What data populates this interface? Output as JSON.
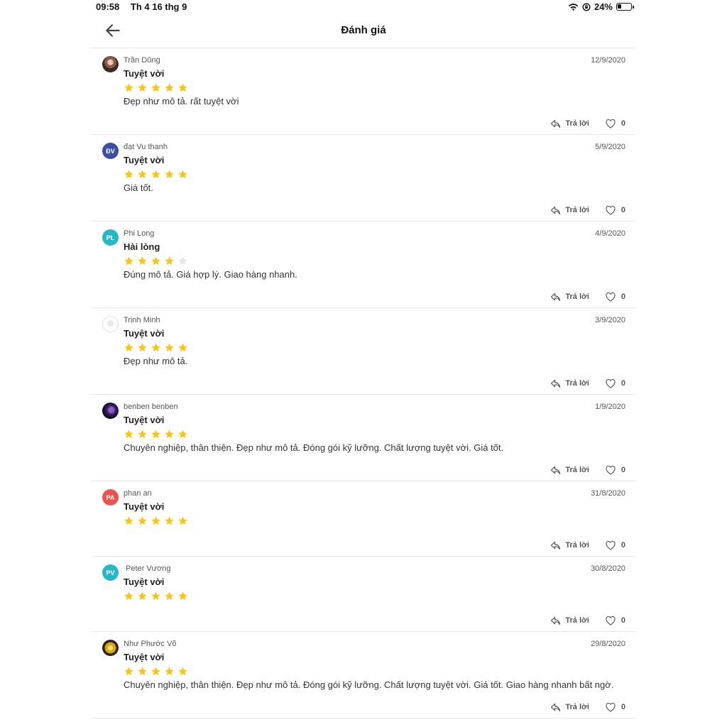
{
  "status_bar": {
    "time": "09:58",
    "date": "Th 4 16 thg 9",
    "battery": "24%"
  },
  "header": {
    "title": "Đánh giá"
  },
  "reply_label": "Trả lời",
  "colors": {
    "star": "#f5c518",
    "star_empty": "#e6e6e6"
  },
  "reviews": [
    {
      "name": "Trần Dũng",
      "avatar_initials": "",
      "avatar_color": "",
      "date": "12/9/2020",
      "title": "Tuyệt vời",
      "rating": 5,
      "comment": "Đẹp như mô tả. rất tuyệt vời",
      "likes": "0"
    },
    {
      "name": "đạt Vu thanh",
      "avatar_initials": "ĐV",
      "avatar_color": "#3b4fa3",
      "date": "5/9/2020",
      "title": "Tuyệt vời",
      "rating": 5,
      "comment": "Giá tốt.",
      "likes": "0"
    },
    {
      "name": "Phi Long",
      "avatar_initials": "PL",
      "avatar_color": "#26b8c6",
      "date": "4/9/2020",
      "title": "Hài lòng",
      "rating": 4,
      "comment": "Đúng mô tả. Giá hợp lý. Giao hàng nhanh.",
      "likes": "0"
    },
    {
      "name": "Trịnh Minh",
      "avatar_initials": "",
      "avatar_color": "",
      "date": "3/9/2020",
      "title": "Tuyệt vời",
      "rating": 5,
      "comment": "Đẹp như mô tả.",
      "likes": "0"
    },
    {
      "name": "benben benben",
      "avatar_initials": "",
      "avatar_color": "",
      "date": "1/9/2020",
      "title": "Tuyệt vời",
      "rating": 5,
      "comment": "Chuyên nghiệp, thân thiện. Đẹp như mô tả. Đóng gói kỹ lưỡng. Chất lượng tuyệt vời. Giá tốt.",
      "likes": "0"
    },
    {
      "name": "phan an",
      "avatar_initials": "PA",
      "avatar_color": "#ef5350",
      "date": "31/8/2020",
      "title": "Tuyệt vời",
      "rating": 5,
      "comment": "",
      "likes": "0"
    },
    {
      "name": "Peter Vương",
      "avatar_initials": "PV",
      "avatar_color": "#26b8c6",
      "date": "30/8/2020",
      "title": "Tuyệt vời",
      "rating": 5,
      "comment": "",
      "likes": "0"
    },
    {
      "name": "Như Phước Võ",
      "avatar_initials": "",
      "avatar_color": "",
      "date": "29/8/2020",
      "title": "Tuyệt vời",
      "rating": 5,
      "comment": "Chuyên nghiệp, thân thiện. Đẹp như mô tả. Đóng gói kỹ lưỡng. Chất lượng tuyệt vời. Giá tốt. Giao hàng nhanh bất ngờ.",
      "likes": "0"
    }
  ]
}
